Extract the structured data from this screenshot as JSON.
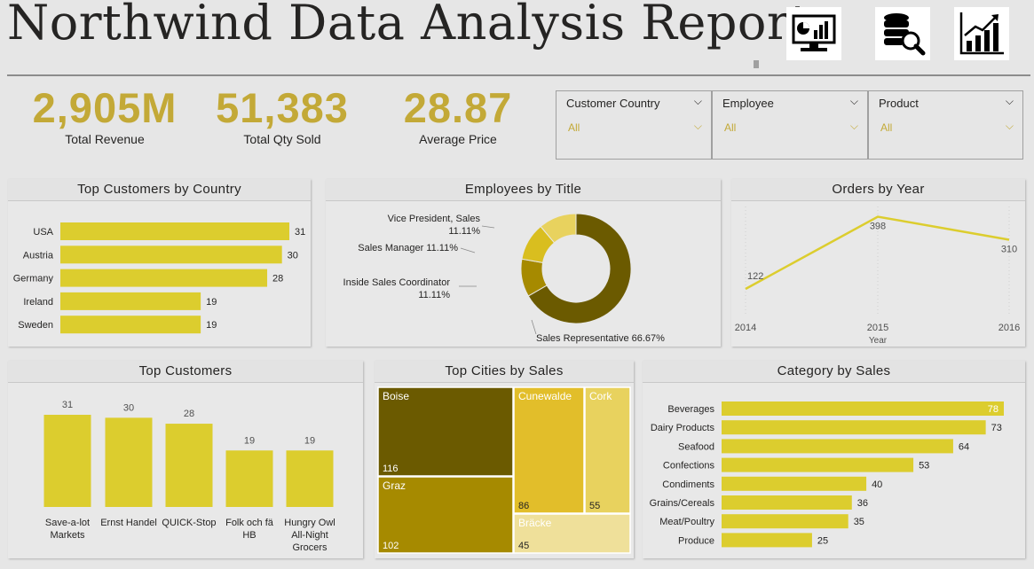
{
  "header": {
    "title": "Northwind Data Analysis Report",
    "icons": [
      "dashboard-monitor-icon",
      "database-search-icon",
      "growth-chart-icon"
    ]
  },
  "kpis": [
    {
      "value": "2,905M",
      "label": "Total Revenue"
    },
    {
      "value": "51,383",
      "label": "Total Qty Sold"
    },
    {
      "value": "28.87",
      "label": "Average Price"
    }
  ],
  "slicers": [
    {
      "label": "Customer Country",
      "value": "All"
    },
    {
      "label": "Employee",
      "value": "All"
    },
    {
      "label": "Product",
      "value": "All"
    }
  ],
  "colors": {
    "accent": "#c3a937",
    "bar": "#dccd2e",
    "dark": "#6b5a00",
    "mid": "#a68a00",
    "light": "#e8d25e"
  },
  "panels": {
    "top_customers_by_country": "Top Customers by Country",
    "employees_by_title": "Employees by Title",
    "orders_by_year": "Orders by Year",
    "top_customers": "Top Customers",
    "top_cities": "Top Cities by Sales",
    "category_by_sales": "Category by Sales"
  },
  "chart_data": [
    {
      "id": "country",
      "type": "bar",
      "title": "Top Customers by Country",
      "categories": [
        "USA",
        "Austria",
        "Germany",
        "Ireland",
        "Sweden"
      ],
      "values": [
        31,
        30,
        28,
        19,
        19
      ]
    },
    {
      "id": "employees",
      "type": "pie",
      "title": "Employees by Title",
      "labels": [
        "Sales Representative",
        "Inside Sales Coordinator",
        "Sales Manager",
        "Vice President, Sales"
      ],
      "values": [
        66.67,
        11.11,
        11.11,
        11.11
      ],
      "display": [
        "Sales Representative 66.67%",
        "Inside Sales Coordinator 11.11%",
        "Sales Manager 11.11%",
        "Vice President, Sales 11.11%"
      ]
    },
    {
      "id": "orders",
      "type": "line",
      "title": "Orders by Year",
      "x": [
        "2014",
        "2015",
        "2016"
      ],
      "values": [
        122,
        398,
        310
      ],
      "xlabel": "Year"
    },
    {
      "id": "customers",
      "type": "bar",
      "title": "Top Customers",
      "categories": [
        "Save-a-lot Markets",
        "Ernst Handel",
        "QUICK-Stop",
        "Folk och fä HB",
        "Hungry Owl All-Night Grocers"
      ],
      "values": [
        31,
        30,
        28,
        19,
        19
      ]
    },
    {
      "id": "cities",
      "type": "heatmap",
      "title": "Top Cities by Sales",
      "labels": [
        "Boise",
        "Graz",
        "Cunewalde",
        "Cork",
        "Bräcke"
      ],
      "values": [
        116,
        102,
        86,
        55,
        45
      ]
    },
    {
      "id": "category",
      "type": "bar",
      "title": "Category by Sales",
      "categories": [
        "Beverages",
        "Dairy Products",
        "Seafood",
        "Confections",
        "Condiments",
        "Grains/Cereals",
        "Meat/Poultry",
        "Produce"
      ],
      "values": [
        78,
        73,
        64,
        53,
        40,
        36,
        35,
        25
      ]
    }
  ]
}
